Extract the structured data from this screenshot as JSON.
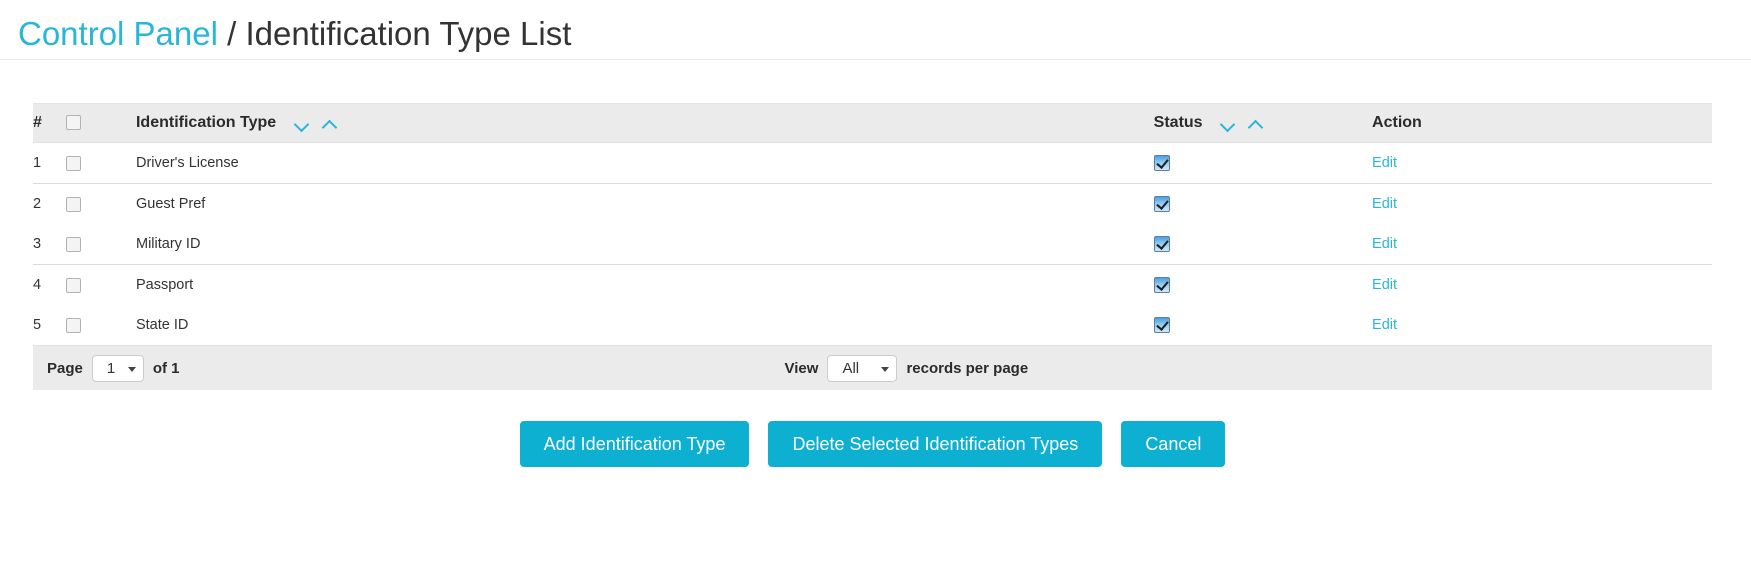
{
  "breadcrumb": {
    "root_label": "Control Panel",
    "separator": "/",
    "current_label": "Identification Type List"
  },
  "colors": {
    "accent": "#29b6d8",
    "button": "#0eb0d2",
    "header_row_bg": "#ebebeb",
    "text": "#333333"
  },
  "table": {
    "columns": {
      "num": "#",
      "select_all": "",
      "name": "Identification Type",
      "status": "Status",
      "action": "Action"
    },
    "sort_icons": {
      "desc": "chevron-down-icon",
      "asc": "chevron-up-icon"
    },
    "rows": [
      {
        "num": "1",
        "name": "Driver's License",
        "status_checked": true,
        "action": "Edit",
        "selected": false
      },
      {
        "num": "2",
        "name": "Guest Pref",
        "status_checked": true,
        "action": "Edit",
        "selected": false
      },
      {
        "num": "3",
        "name": "Military ID",
        "status_checked": true,
        "action": "Edit",
        "selected": false
      },
      {
        "num": "4",
        "name": "Passport",
        "status_checked": true,
        "action": "Edit",
        "selected": false
      },
      {
        "num": "5",
        "name": "State ID",
        "status_checked": true,
        "action": "Edit",
        "selected": false
      }
    ]
  },
  "pager": {
    "page_label": "Page",
    "page_value": "1",
    "of_label": "of 1",
    "view_label": "View",
    "view_value": "All",
    "records_label": "records per page"
  },
  "buttons": {
    "add": "Add Identification Type",
    "delete": "Delete Selected Identification Types",
    "cancel": "Cancel"
  }
}
